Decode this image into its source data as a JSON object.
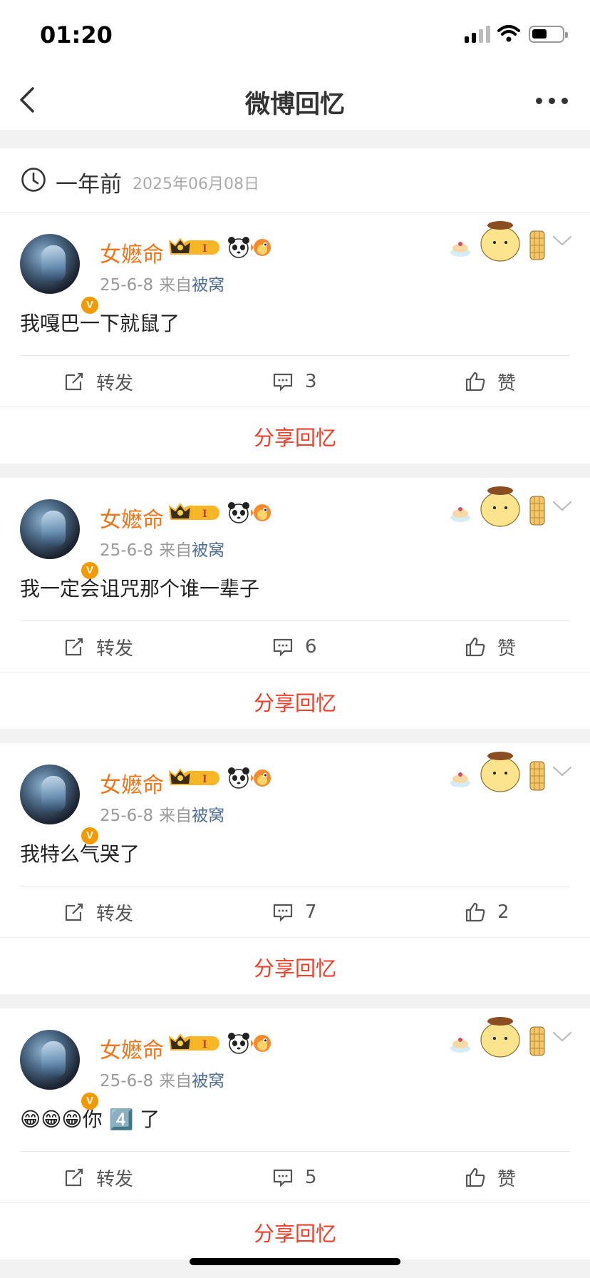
{
  "status_bar": {
    "time": "01:20"
  },
  "nav": {
    "title": "微博回忆"
  },
  "date_header": {
    "ago": "一年前",
    "date": "2025年06月08日"
  },
  "share_label": "分享回忆",
  "posts": [
    {
      "username": "女嬷命",
      "date": "25-6-8",
      "from": "来自",
      "source": "被窝",
      "text": "我嘎巴一下就鼠了",
      "repost": "转发",
      "comments": "3",
      "likes": "赞"
    },
    {
      "username": "女嬷命",
      "date": "25-6-8",
      "from": "来自",
      "source": "被窝",
      "text": "我一定会诅咒那个谁一辈子",
      "repost": "转发",
      "comments": "6",
      "likes": "赞"
    },
    {
      "username": "女嬷命",
      "date": "25-6-8",
      "from": "来自",
      "source": "被窝",
      "text": "我特么气哭了",
      "repost": "转发",
      "comments": "7",
      "likes": "2"
    },
    {
      "username": "女嬷命",
      "date": "25-6-8",
      "from": "来自",
      "source": "被窝",
      "text": "😁😁😁你 4️⃣ 了",
      "repost": "转发",
      "comments": "5",
      "likes": "赞"
    }
  ],
  "badges": {
    "vip_level": "I",
    "verified": "V"
  },
  "colors": {
    "accent": "#ee3f2a",
    "username": "#f0751a",
    "source_link": "#4f6d96"
  }
}
